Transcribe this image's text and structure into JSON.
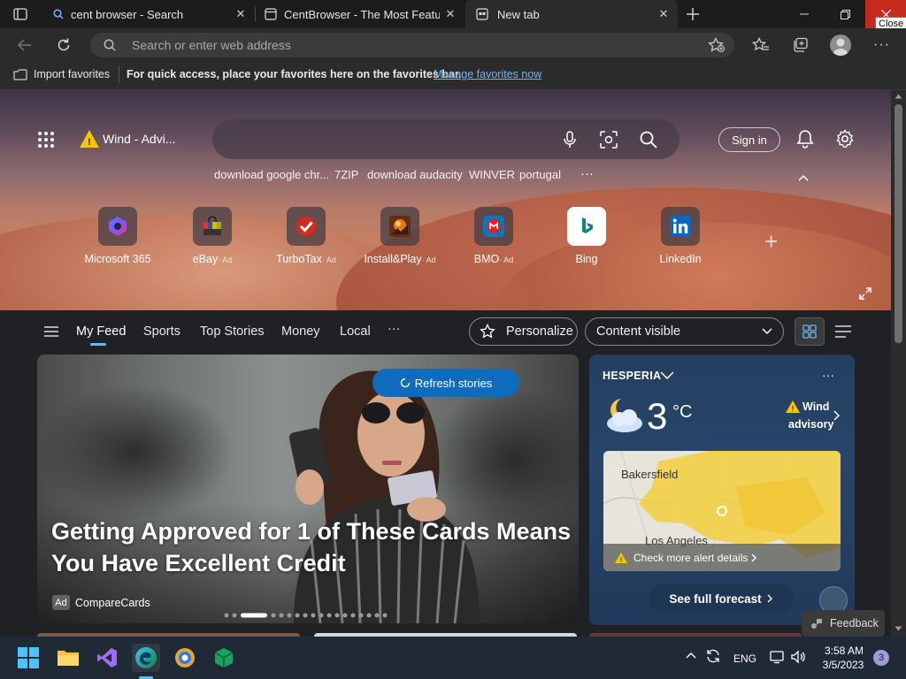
{
  "browser": {
    "tabs": [
      {
        "label": "cent browser - Search",
        "active": false
      },
      {
        "label": "CentBrowser - The Most Feature",
        "active": false
      },
      {
        "label": "New tab",
        "active": true
      }
    ],
    "address_placeholder": "Search or enter web address",
    "close_tooltip": "Close"
  },
  "favorites_bar": {
    "import_label": "Import favorites",
    "hint": "For quick access, place your favorites here on the favorites bar.",
    "manage_link": "Manage favorites now"
  },
  "newtab": {
    "weather_chip": "Wind - Advi...",
    "sign_in": "Sign in",
    "suggestions": [
      "download google chr...",
      "7ZIP",
      "download audacity",
      "WINVER",
      "portugal"
    ],
    "more": "···",
    "tiles": [
      {
        "label": "Microsoft 365",
        "ad": ""
      },
      {
        "label": "eBay",
        "ad": "· Ad"
      },
      {
        "label": "TurboTax",
        "ad": "· Ad"
      },
      {
        "label": "Install&Play",
        "ad": "· Ad"
      },
      {
        "label": "BMO",
        "ad": "· Ad"
      },
      {
        "label": "Bing",
        "ad": ""
      },
      {
        "label": "LinkedIn",
        "ad": ""
      }
    ],
    "add_tile": "+"
  },
  "feed_nav": {
    "items": [
      "My Feed",
      "Sports",
      "Top Stories",
      "Money",
      "Local"
    ],
    "more": "···",
    "personalize": "Personalize",
    "content_visible": "Content visible"
  },
  "hero_card": {
    "refresh": "Refresh stories",
    "title": "Getting Approved for 1 of These Cards Means You Have Excellent Credit",
    "ad_badge": "Ad",
    "source": "CompareCards"
  },
  "weather": {
    "location": "HESPERIA",
    "temp": "3",
    "unit": "°C",
    "alert_line1": "Wind",
    "alert_line2": "advisory",
    "map_city1": "Bakersfield",
    "map_city2": "Los Angeles",
    "alert_details": "Check more alert details",
    "forecast_btn": "See full forecast",
    "more": "···"
  },
  "feedback": "Feedback",
  "taskbar": {
    "lang": "ENG",
    "time": "3:58 AM",
    "date": "3/5/2023",
    "notifications": "3"
  },
  "colors": {
    "accent": "#0f6cbd",
    "link": "#6cb8f6",
    "close_red": "#c42b1c"
  }
}
